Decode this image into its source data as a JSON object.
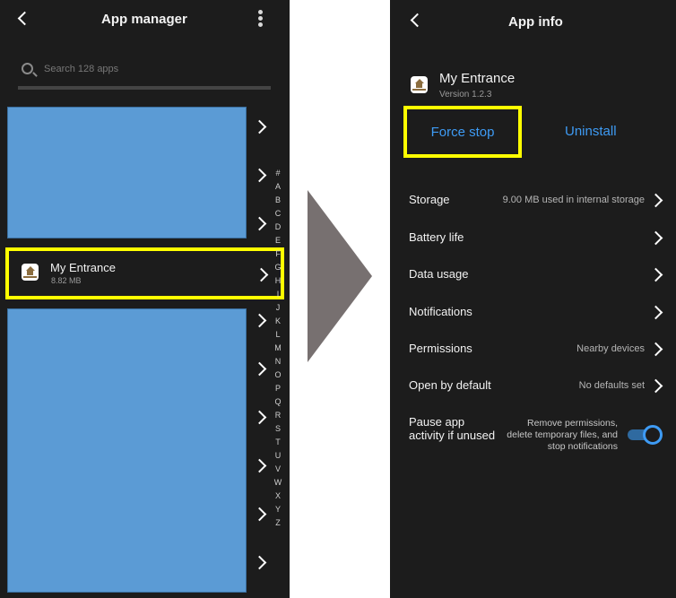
{
  "left": {
    "title": "App manager",
    "search_placeholder": "Search 128 apps",
    "selected_app": {
      "name": "My Entrance",
      "size": "8.82 MB"
    },
    "alphabet": [
      "#",
      "A",
      "B",
      "C",
      "D",
      "E",
      "F",
      "G",
      "H",
      "I",
      "J",
      "K",
      "L",
      "M",
      "N",
      "O",
      "P",
      "Q",
      "R",
      "S",
      "T",
      "U",
      "V",
      "W",
      "X",
      "Y",
      "Z"
    ]
  },
  "right": {
    "title": "App info",
    "app": {
      "name": "My Entrance",
      "version": "Version 1.2.3"
    },
    "buttons": {
      "force_stop": "Force stop",
      "uninstall": "Uninstall"
    },
    "settings": [
      {
        "label": "Storage",
        "value": "9.00 MB used in internal storage"
      },
      {
        "label": "Battery life",
        "value": ""
      },
      {
        "label": "Data usage",
        "value": ""
      },
      {
        "label": "Notifications",
        "value": ""
      },
      {
        "label": "Permissions",
        "value": "Nearby devices"
      },
      {
        "label": "Open by default",
        "value": "No defaults set"
      }
    ],
    "pause": {
      "label": "Pause app activity if unused",
      "description": "Remove permissions, delete temporary files, and stop notifications",
      "enabled": true
    }
  },
  "colors": {
    "accent": "#3e9bf4",
    "highlight": "#ffff00",
    "placeholder_block": "#5b9bd5"
  }
}
